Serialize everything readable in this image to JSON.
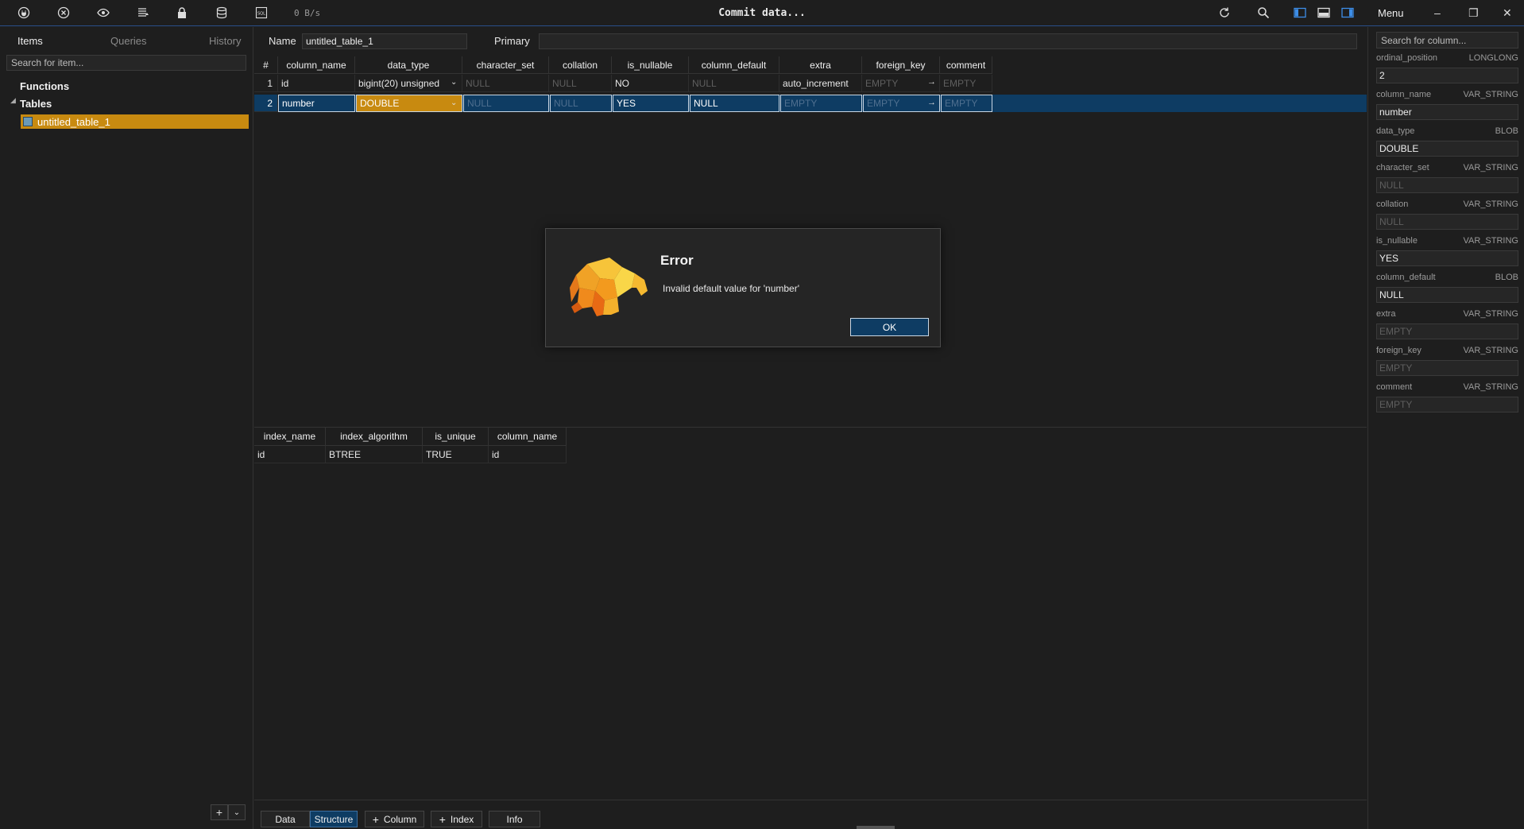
{
  "topbar": {
    "icons": [
      "plug-icon",
      "close-circle-icon",
      "eye-icon",
      "filter-list-icon",
      "lock-icon",
      "database-icon",
      "sql-icon"
    ],
    "speed": "0 B/s",
    "title": "Commit data...",
    "right_icons": [
      "refresh-icon",
      "search-icon",
      "layout-left-icon",
      "layout-bottom-icon",
      "layout-right-icon"
    ],
    "menu_label": "Menu",
    "window_controls": [
      "minimize-icon",
      "restore-icon",
      "close-icon"
    ]
  },
  "sidebar": {
    "tabs": [
      {
        "label": "Items",
        "active": true
      },
      {
        "label": "Queries",
        "active": false
      },
      {
        "label": "History",
        "active": false
      }
    ],
    "search_placeholder": "Search for item...",
    "functions_label": "Functions",
    "tables_label": "Tables",
    "selected_table": "untitled_table_1",
    "add_button": "+",
    "dropdown_button": "⌵"
  },
  "main": {
    "name_label": "Name",
    "name_value": "untitled_table_1",
    "primary_label": "Primary",
    "primary_value": "",
    "columns_grid": {
      "headers": [
        "#",
        "column_name",
        "data_type",
        "character_set",
        "collation",
        "is_nullable",
        "column_default",
        "extra",
        "foreign_key",
        "comment"
      ],
      "rows": [
        {
          "num": "1",
          "column_name": "id",
          "data_type": "bigint(20) unsigned",
          "character_set": "NULL",
          "collation": "NULL",
          "is_nullable": "NO",
          "column_default": "NULL",
          "extra": "auto_increment",
          "foreign_key": "EMPTY",
          "comment": "EMPTY"
        },
        {
          "num": "2",
          "column_name": "number",
          "data_type": "DOUBLE",
          "character_set": "NULL",
          "collation": "NULL",
          "is_nullable": "YES",
          "column_default": "NULL",
          "extra": "EMPTY",
          "foreign_key": "EMPTY",
          "comment": "EMPTY"
        }
      ]
    },
    "index_grid": {
      "headers": [
        "index_name",
        "index_algorithm",
        "is_unique",
        "column_name"
      ],
      "rows": [
        {
          "index_name": "id",
          "index_algorithm": "BTREE",
          "is_unique": "TRUE",
          "column_name": "id"
        }
      ]
    },
    "bottom_tabs": {
      "data": "Data",
      "structure": "Structure",
      "column": "Column",
      "index": "Index",
      "info": "Info",
      "active": "Structure"
    }
  },
  "right_panel": {
    "search_placeholder": "Search for column...",
    "fields": [
      {
        "name": "ordinal_position",
        "type": "LONGLONG",
        "value": "2"
      },
      {
        "name": "column_name",
        "type": "VAR_STRING",
        "value": "number"
      },
      {
        "name": "data_type",
        "type": "BLOB",
        "value": "DOUBLE"
      },
      {
        "name": "character_set",
        "type": "VAR_STRING",
        "value": "NULL"
      },
      {
        "name": "collation",
        "type": "VAR_STRING",
        "value": "NULL"
      },
      {
        "name": "is_nullable",
        "type": "VAR_STRING",
        "value": "YES"
      },
      {
        "name": "column_default",
        "type": "BLOB",
        "value": "NULL"
      },
      {
        "name": "extra",
        "type": "VAR_STRING",
        "value": "EMPTY"
      },
      {
        "name": "foreign_key",
        "type": "VAR_STRING",
        "value": "EMPTY"
      },
      {
        "name": "comment",
        "type": "VAR_STRING",
        "value": "EMPTY"
      }
    ]
  },
  "dialog": {
    "title": "Error",
    "message": "Invalid default value for 'number'",
    "ok_label": "OK",
    "logo": "elephant-logo"
  },
  "colors": {
    "accent": "#0e3c63",
    "selection_orange": "#c88a10",
    "background": "#1e1e1e"
  }
}
